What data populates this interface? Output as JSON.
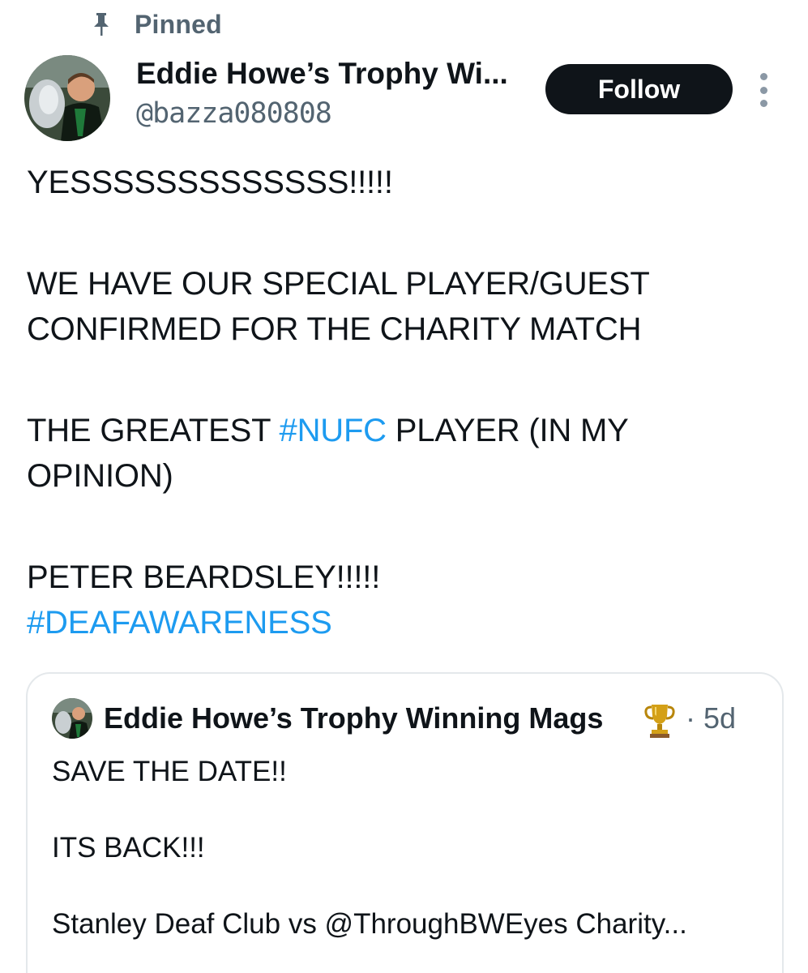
{
  "pinned": {
    "label": "Pinned",
    "icon": "pin-icon"
  },
  "author": {
    "display_name": "Eddie Howe’s Trophy Wi...",
    "handle": "@bazza080808",
    "avatar_icon": "avatar"
  },
  "follow": {
    "label": "Follow"
  },
  "more": {
    "icon": "more-vertical-icon"
  },
  "tweet": {
    "line1": "YESSSSSSSSSSSSS!!!!!",
    "line2": "WE HAVE OUR SPECIAL PLAYER/GUEST",
    "line3": "CONFIRMED FOR THE CHARITY MATCH",
    "line4_pre": "THE GREATEST ",
    "line4_tag": "#NUFC",
    "line4_post": " PLAYER (IN MY",
    "line5": "OPINION)",
    "line6": "PETER BEARDSLEY!!!!!",
    "line7_tag": "#DEAFAWARENESS"
  },
  "quote": {
    "display_name": "Eddie Howe’s Trophy Winning Mags",
    "trophy_icon": "trophy-icon",
    "time": "· 5d",
    "line1": "SAVE THE DATE!!",
    "line2": "ITS BACK!!!",
    "line3": "Stanley Deaf Club vs @ThroughBWEyes Charity..."
  },
  "colors": {
    "text": "#0f1419",
    "secondary": "#536471",
    "link": "#1d9bf0",
    "button_bg": "#0f1419",
    "border": "#e4e8eb"
  }
}
